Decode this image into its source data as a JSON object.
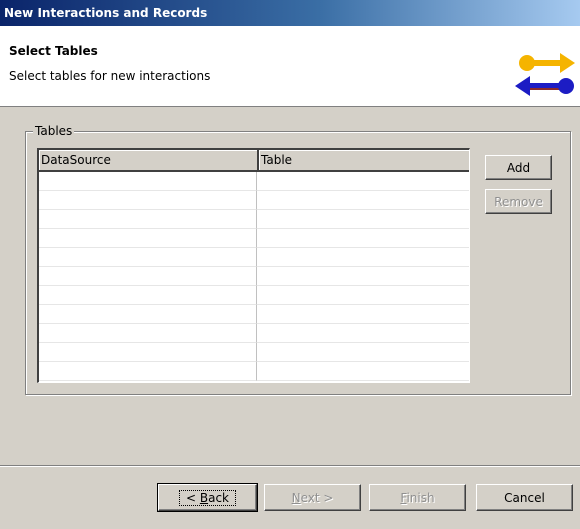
{
  "window": {
    "title": "New Interactions and Records"
  },
  "banner": {
    "title": "Select Tables",
    "description": "Select tables for new interactions",
    "icon": "wizard-arrows-icon",
    "icon_colors": {
      "top": "#f5b400",
      "bottom": "#1c1cc4"
    }
  },
  "tables_group": {
    "label": "Tables",
    "columns": [
      "DataSource",
      "Table"
    ],
    "rows": [],
    "empty_row_count": 11
  },
  "side_buttons": {
    "add": {
      "label": "Add",
      "enabled": true
    },
    "remove": {
      "label": "Remove",
      "enabled": false
    }
  },
  "footer": {
    "back": {
      "prefix": "< ",
      "mnemonic": "B",
      "rest": "ack",
      "enabled": true
    },
    "next": {
      "mnemonic": "N",
      "rest": "ext >",
      "enabled": false
    },
    "finish": {
      "mnemonic": "F",
      "rest": "inish",
      "enabled": false
    },
    "cancel": {
      "label": "Cancel",
      "enabled": true
    }
  }
}
